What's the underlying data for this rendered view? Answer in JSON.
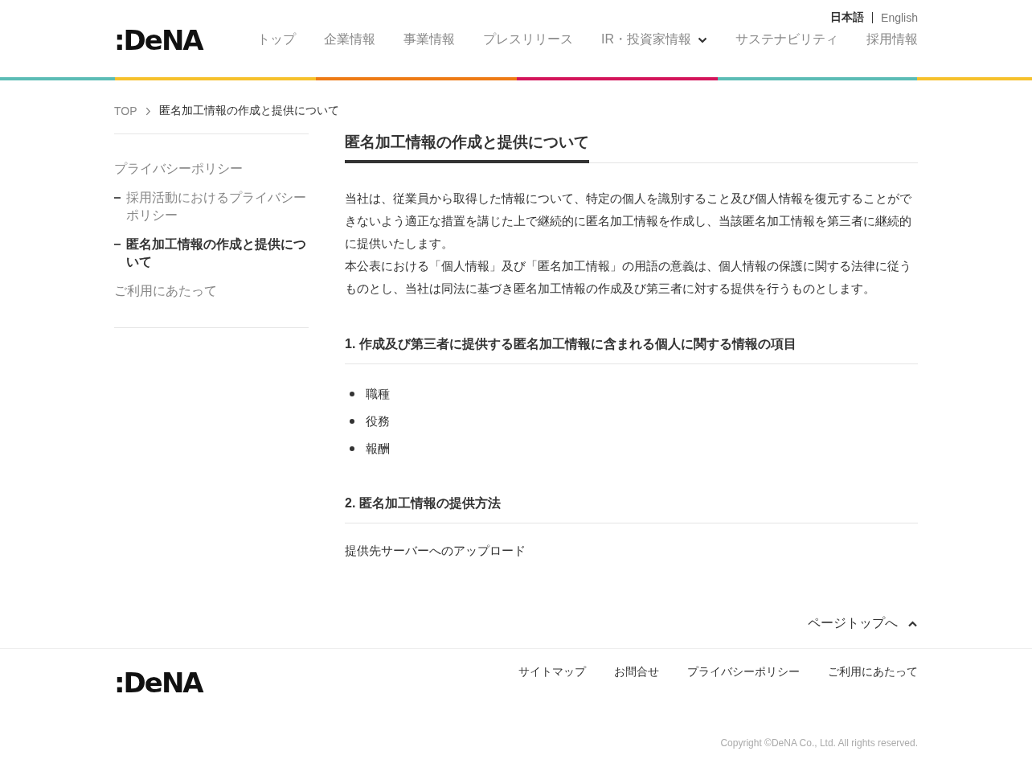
{
  "header": {
    "logo": ":DeNA",
    "languages": [
      {
        "label": "日本語",
        "selected": true
      },
      {
        "label": "English",
        "selected": false
      }
    ],
    "nav": [
      {
        "label": "トップ",
        "dropdown": false
      },
      {
        "label": "企業情報",
        "dropdown": false
      },
      {
        "label": "事業情報",
        "dropdown": false
      },
      {
        "label": "プレスリリース",
        "dropdown": false
      },
      {
        "label": "IR・投資家情報",
        "dropdown": true
      },
      {
        "label": "サステナビリティ",
        "dropdown": false
      },
      {
        "label": "採用情報",
        "dropdown": false
      }
    ]
  },
  "breadcrumb": [
    "TOP",
    "匿名加工情報の作成と提供について"
  ],
  "sidebar": {
    "items": [
      {
        "label": "プライバシーポリシー",
        "selected": false,
        "children": [
          {
            "label": "採用活動におけるプライバシーポリシー",
            "selected": false
          },
          {
            "label": "匿名加工情報の作成と提供について",
            "selected": true
          }
        ]
      },
      {
        "label": "ご利用にあたって",
        "selected": false
      }
    ]
  },
  "article": {
    "title": "匿名加工情報の作成と提供について",
    "intro": [
      "当社は、従業員から取得した情報について、特定の個人を識別すること及び個人情報を復元することができないよう適正な措置を講じた上で継続的に匿名加工情報を作成し、当該匿名加工情報を第三者に継続的に提供いたします。",
      "本公表における「個人情報」及び「匿名加工情報」の用語の意義は、個人情報の保護に関する法律に従うものとし、当社は同法に基づき匿名加工情報の作成及び第三者に対する提供を行うものとします。"
    ],
    "sections": [
      {
        "heading": "1. 作成及び第三者に提供する匿名加工情報に含まれる個人に関する情報の項目",
        "kind": "list",
        "items": [
          "職種",
          "役務",
          "報酬"
        ]
      },
      {
        "heading": "2. 匿名加工情報の提供方法",
        "kind": "text",
        "text": "提供先サーバーへのアップロード"
      }
    ]
  },
  "page_top": "ページトップへ",
  "footer": {
    "logo": ":DeNA",
    "links": [
      "サイトマップ",
      "お問合せ",
      "プライバシーポリシー",
      "ご利用にあたって"
    ],
    "copyright": "Copyright ©DeNA Co., Ltd. All rights reserved."
  }
}
